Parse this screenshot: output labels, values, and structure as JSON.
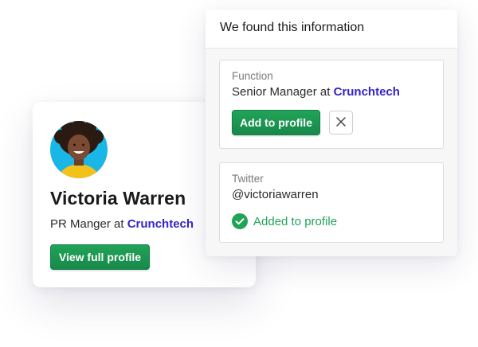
{
  "profile_card": {
    "name": "Victoria Warren",
    "role_prefix": "PR Manger at ",
    "company": "Crunchtech",
    "view_button_label": "View full profile"
  },
  "info_panel": {
    "title": "We found this information",
    "function_card": {
      "label": "Function",
      "value_prefix": "Senior Manager at ",
      "company": "Crunchtech",
      "add_button_label": "Add to profile",
      "dismiss_icon": "close-icon"
    },
    "twitter_card": {
      "label": "Twitter",
      "value": "@victoriawarren",
      "status_icon": "check-circle-icon",
      "status_text": "Added to profile"
    }
  },
  "colors": {
    "accent_green": "#21a358",
    "company_link": "#3524c9",
    "avatar_background": "#1ab6e6"
  }
}
